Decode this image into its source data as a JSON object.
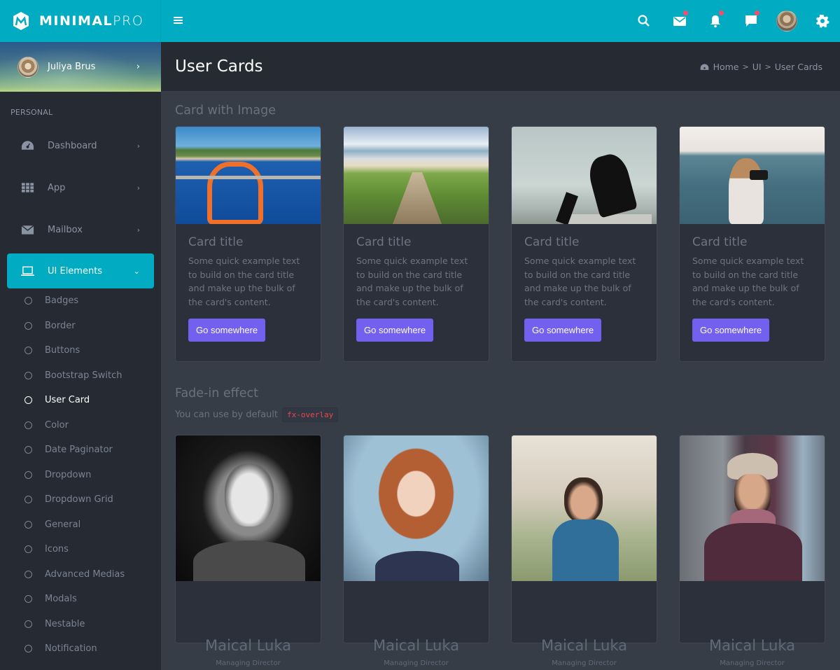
{
  "app": {
    "brand_bold": "MINIMAL",
    "brand_light": "PRO"
  },
  "topbar": {
    "icons": [
      "menu-icon",
      "search-icon",
      "mail-icon",
      "bell-icon",
      "chat-icon",
      "avatar",
      "gear-icon"
    ],
    "badge_color": "#ff4a6b",
    "bar_color": "#01abc1"
  },
  "sidebar": {
    "user_name": "Juliya Brus",
    "section_label": "PERSONAL",
    "items": [
      {
        "label": "Dashboard",
        "icon": "dashboard-icon"
      },
      {
        "label": "App",
        "icon": "grid-icon"
      },
      {
        "label": "Mailbox",
        "icon": "mail-icon"
      },
      {
        "label": "UI Elements",
        "icon": "laptop-icon",
        "active": true
      }
    ],
    "sub_items": [
      {
        "label": "Badges"
      },
      {
        "label": "Border"
      },
      {
        "label": "Buttons"
      },
      {
        "label": "Bootstrap Switch"
      },
      {
        "label": "User Card",
        "current": true
      },
      {
        "label": "Color"
      },
      {
        "label": "Date Paginator"
      },
      {
        "label": "Dropdown"
      },
      {
        "label": "Dropdown Grid"
      },
      {
        "label": "General"
      },
      {
        "label": "Icons"
      },
      {
        "label": "Advanced Medias"
      },
      {
        "label": "Modals"
      },
      {
        "label": "Nestable"
      },
      {
        "label": "Notification"
      }
    ]
  },
  "header": {
    "title": "User Cards",
    "breadcrumb": [
      "Home",
      "UI",
      "User Cards"
    ]
  },
  "section1": {
    "title": "Card with Image",
    "cards": [
      {
        "image": "orange rope on boat railing",
        "title": "Card title",
        "text": "Some quick example text to build on the card title and make up the bulk of the card's content.",
        "button": "Go somewhere"
      },
      {
        "image": "wooden stairs to beach",
        "title": "Card title",
        "text": "Some quick example text to build on the card title and make up the bulk of the card's content.",
        "button": "Go somewhere"
      },
      {
        "image": "woman sitting in black dress",
        "title": "Card title",
        "text": "Some quick example text to build on the card title and make up the bulk of the card's content.",
        "button": "Go somewhere"
      },
      {
        "image": "woman with camera by sea",
        "title": "Card title",
        "text": "Some quick example text to build on the card title and make up the bulk of the card's content.",
        "button": "Go somewhere"
      }
    ]
  },
  "section2": {
    "title": "Fade-in effect",
    "subtitle": "You can use by default",
    "code": "fx-overlay",
    "profiles": [
      {
        "image": "smiling man black and white",
        "name": "Maical Luka",
        "role": "Managing Director"
      },
      {
        "image": "red-haired woman",
        "name": "Maical Luka",
        "role": "Managing Director"
      },
      {
        "image": "woman with glasses",
        "name": "Maical Luka",
        "role": "Managing Director"
      },
      {
        "image": "man with hat and scarf",
        "name": "Maical Luka",
        "role": "Managing Director"
      }
    ]
  },
  "colors": {
    "accent": "#01abc1",
    "button": "#7460ee",
    "code_text": "#e5484d"
  }
}
